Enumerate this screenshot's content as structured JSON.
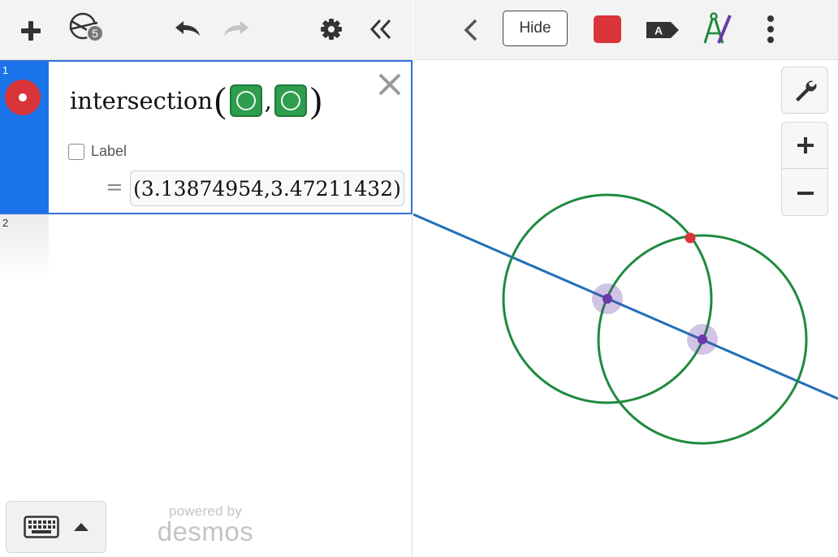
{
  "toolbar": {
    "geometry_badge": "5"
  },
  "expressions": [
    {
      "index": "1",
      "function_name": "intersection",
      "arg_separator": ",",
      "label_checkbox": "Label",
      "label_checked": false,
      "equals": "=",
      "value": "(3.13874954,3.47211432)",
      "color": "#d8343a"
    },
    {
      "index": "2"
    }
  ],
  "footer": {
    "powered_by": "powered by",
    "brand": "desmos"
  },
  "graph_toolbar": {
    "hide_label": "Hide",
    "selected_color": "#d8343a"
  },
  "colors": {
    "accent_blue": "#1a73e8",
    "circle_green": "#1e8a3c",
    "line_blue": "#2070b8",
    "point_purple": "#6a3aa8",
    "intersection_red": "#d8343a"
  }
}
